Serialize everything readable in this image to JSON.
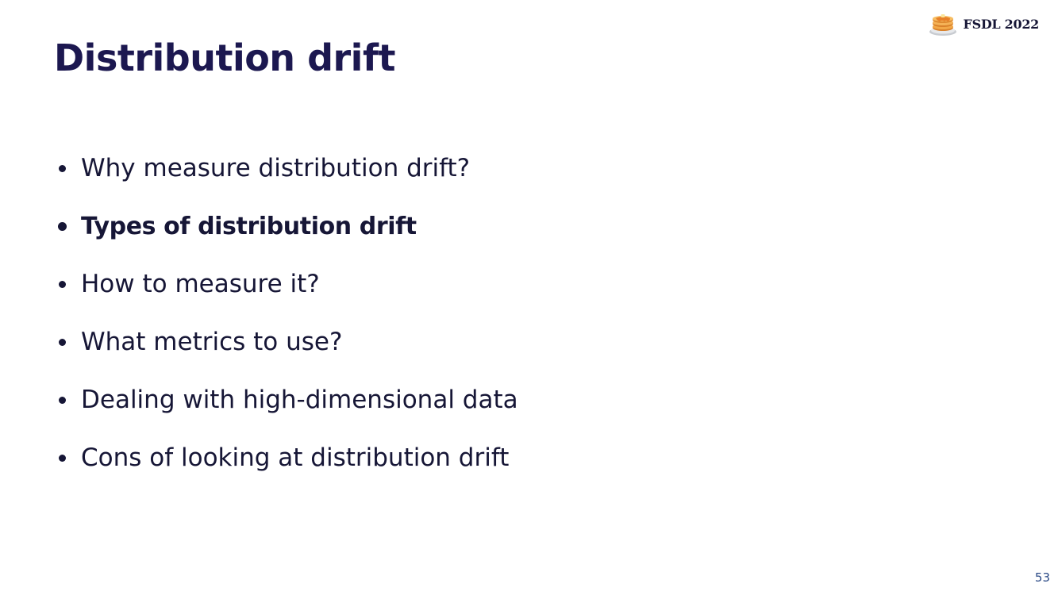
{
  "header": {
    "brand_text": "FSDL 2022",
    "brand_icon": "pancake-stack-icon"
  },
  "slide": {
    "title": "Distribution drift",
    "bullets": [
      {
        "text": "Why measure distribution drift?",
        "active": false
      },
      {
        "text": "Types of distribution drift",
        "active": true
      },
      {
        "text": "How to measure it?",
        "active": false
      },
      {
        "text": "What metrics to use?",
        "active": false
      },
      {
        "text": "Dealing with high-dimensional data",
        "active": false
      },
      {
        "text": "Cons of looking at distribution drift",
        "active": false
      }
    ]
  },
  "footer": {
    "page_number": "53"
  },
  "colors": {
    "title": "#1c1850",
    "text": "#161636",
    "page_number": "#2b4a86",
    "background": "#ffffff"
  }
}
